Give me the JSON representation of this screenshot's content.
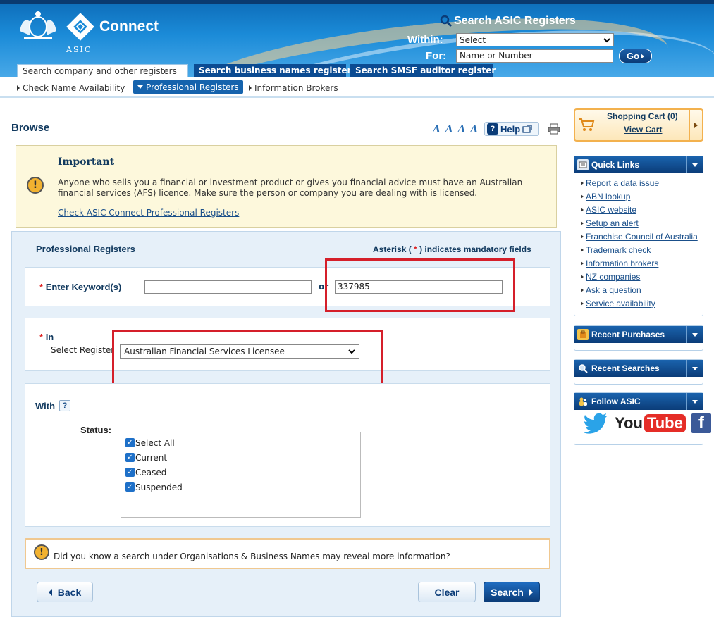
{
  "header": {
    "brand": "Connect",
    "agency": "ASIC",
    "search_title": "Search ASIC Registers",
    "within_label": "Within:",
    "within_value": "Select",
    "for_label": "For:",
    "for_placeholder": "Name or Number",
    "go_label": "Go",
    "tabs": [
      {
        "label": "Search company and other registers"
      },
      {
        "label": "Search business names register"
      },
      {
        "label": "Search SMSF auditor register"
      }
    ]
  },
  "subnav": {
    "items": [
      {
        "label": "Check Name Availability"
      },
      {
        "label": "Professional Registers"
      },
      {
        "label": "Information Brokers"
      }
    ]
  },
  "page": {
    "title": "Browse",
    "font_sizer": "A A A A",
    "help_label": "Help"
  },
  "important": {
    "title": "Important",
    "text": "Anyone who sells you a financial or investment product or gives you financial advice must have an Australian financial services (AFS) licence. Make sure the person or company you are dealing with is licensed.",
    "link": "Check ASIC Connect Professional Registers"
  },
  "form": {
    "title": "Professional Registers",
    "mandatory_prefix": "Asterisk (",
    "mandatory_star": "*",
    "mandatory_suffix": ") indicates mandatory fields",
    "star": "*",
    "keyword_label": "Enter Keyword(s)",
    "keyword_value": "",
    "or_label": "or",
    "number_value": "337985",
    "in_label": "In",
    "select_register_label": "Select Register",
    "register_value": "Australian Financial Services Licensee",
    "with_label": "With",
    "with_help": "?",
    "status_label": "Status:",
    "status_options": [
      {
        "label": "Select All",
        "checked": true
      },
      {
        "label": "Current",
        "checked": true
      },
      {
        "label": "Ceased",
        "checked": true
      },
      {
        "label": "Suspended",
        "checked": true
      }
    ],
    "info_text": "Did you know a search under Organisations & Business Names may reveal more information?",
    "back_label": "Back",
    "clear_label": "Clear",
    "search_label": "Search"
  },
  "sidebar": {
    "cart_title": "Shopping Cart (0)",
    "cart_link": "View Cart",
    "quick_links_title": "Quick Links",
    "quick_links": [
      "Report a data issue",
      "ABN lookup",
      "ASIC website",
      "Setup an alert",
      "Franchise Council of Australia",
      "Trademark check",
      "Information brokers",
      "NZ companies",
      "Ask a question",
      "Service availability"
    ],
    "recent_purchases_title": "Recent Purchases",
    "recent_searches_title": "Recent Searches",
    "follow_title": "Follow ASIC",
    "youtube_you": "You",
    "youtube_tube": "Tube",
    "facebook_letter": "f"
  },
  "colors": {
    "header_blue": "#1b8bd8",
    "nav_dark_blue": "#0b3c78",
    "highlight_red": "#d51f2a",
    "cart_orange": "#f3b14e",
    "important_bg": "#fdf8dc"
  }
}
